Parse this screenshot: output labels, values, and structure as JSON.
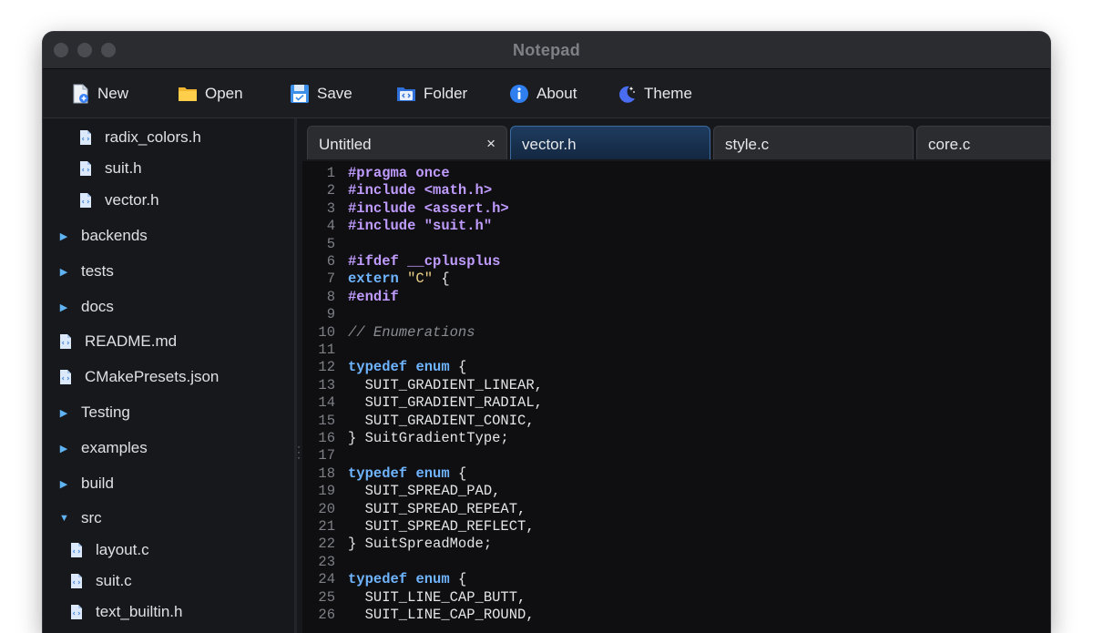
{
  "window": {
    "title": "Notepad"
  },
  "toolbar": {
    "new_label": "New",
    "open_label": "Open",
    "save_label": "Save",
    "folder_label": "Folder",
    "about_label": "About",
    "theme_label": "Theme"
  },
  "sidebar": {
    "items": [
      {
        "label": "radix_colors.h",
        "kind": "file"
      },
      {
        "label": "suit.h",
        "kind": "file"
      },
      {
        "label": "vector.h",
        "kind": "file"
      },
      {
        "label": "backends",
        "kind": "folder-collapsed"
      },
      {
        "label": "tests",
        "kind": "folder-collapsed"
      },
      {
        "label": "docs",
        "kind": "folder-collapsed"
      },
      {
        "label": "README.md",
        "kind": "file"
      },
      {
        "label": "CMakePresets.json",
        "kind": "file"
      },
      {
        "label": "Testing",
        "kind": "folder-collapsed"
      },
      {
        "label": "examples",
        "kind": "folder-collapsed"
      },
      {
        "label": "build",
        "kind": "folder-collapsed"
      },
      {
        "label": "src",
        "kind": "folder-expanded"
      },
      {
        "label": "layout.c",
        "kind": "file"
      },
      {
        "label": "suit.c",
        "kind": "file"
      },
      {
        "label": "text_builtin.h",
        "kind": "file"
      }
    ]
  },
  "tabs": [
    {
      "label": "Untitled",
      "close": "×",
      "active": false
    },
    {
      "label": "vector.h",
      "active": true
    },
    {
      "label": "style.c",
      "active": false
    },
    {
      "label": "core.c",
      "active": false
    }
  ],
  "editor": {
    "lines": [
      {
        "n": "1",
        "t": [
          [
            "kw-purple",
            "#pragma once"
          ]
        ]
      },
      {
        "n": "2",
        "t": [
          [
            "kw-purple",
            "#include <math.h>"
          ]
        ]
      },
      {
        "n": "3",
        "t": [
          [
            "kw-purple",
            "#include <assert.h>"
          ]
        ]
      },
      {
        "n": "4",
        "t": [
          [
            "kw-purple",
            "#include \"suit.h\""
          ]
        ]
      },
      {
        "n": "5",
        "t": []
      },
      {
        "n": "6",
        "t": [
          [
            "kw-purple",
            "#ifdef __cplusplus"
          ]
        ]
      },
      {
        "n": "7",
        "t": [
          [
            "kw-blue",
            "extern"
          ],
          [
            "plain",
            " "
          ],
          [
            "str",
            "\"C\""
          ],
          [
            "plain",
            " {"
          ]
        ]
      },
      {
        "n": "8",
        "t": [
          [
            "kw-purple",
            "#endif"
          ]
        ]
      },
      {
        "n": "9",
        "t": []
      },
      {
        "n": "10",
        "t": [
          [
            "comment",
            "// Enumerations"
          ]
        ]
      },
      {
        "n": "11",
        "t": []
      },
      {
        "n": "12",
        "t": [
          [
            "kw-blue",
            "typedef"
          ],
          [
            "plain",
            " "
          ],
          [
            "kw-blue",
            "enum"
          ],
          [
            "plain",
            " {"
          ]
        ]
      },
      {
        "n": "13",
        "t": [
          [
            "plain",
            "  SUIT_GRADIENT_LINEAR,"
          ]
        ]
      },
      {
        "n": "14",
        "t": [
          [
            "plain",
            "  SUIT_GRADIENT_RADIAL,"
          ]
        ]
      },
      {
        "n": "15",
        "t": [
          [
            "plain",
            "  SUIT_GRADIENT_CONIC,"
          ]
        ]
      },
      {
        "n": "16",
        "t": [
          [
            "plain",
            "} SuitGradientType;"
          ]
        ]
      },
      {
        "n": "17",
        "t": []
      },
      {
        "n": "18",
        "t": [
          [
            "kw-blue",
            "typedef"
          ],
          [
            "plain",
            " "
          ],
          [
            "kw-blue",
            "enum"
          ],
          [
            "plain",
            " {"
          ]
        ]
      },
      {
        "n": "19",
        "t": [
          [
            "plain",
            "  SUIT_SPREAD_PAD,"
          ]
        ]
      },
      {
        "n": "20",
        "t": [
          [
            "plain",
            "  SUIT_SPREAD_REPEAT,"
          ]
        ]
      },
      {
        "n": "21",
        "t": [
          [
            "plain",
            "  SUIT_SPREAD_REFLECT,"
          ]
        ]
      },
      {
        "n": "22",
        "t": [
          [
            "plain",
            "} SuitSpreadMode;"
          ]
        ]
      },
      {
        "n": "23",
        "t": []
      },
      {
        "n": "24",
        "t": [
          [
            "kw-blue",
            "typedef"
          ],
          [
            "plain",
            " "
          ],
          [
            "kw-blue",
            "enum"
          ],
          [
            "plain",
            " {"
          ]
        ]
      },
      {
        "n": "25",
        "t": [
          [
            "plain",
            "  SUIT_LINE_CAP_BUTT,"
          ]
        ]
      },
      {
        "n": "26",
        "t": [
          [
            "plain",
            "  SUIT_LINE_CAP_ROUND,"
          ]
        ]
      }
    ]
  },
  "icons": {
    "file": "code-file-icon",
    "chevron_right": "chevron-right-icon",
    "chevron_down": "chevron-down-icon"
  },
  "colors": {
    "accent": "#6fb4ff",
    "keyword_purple": "#c09cff",
    "string": "#f0d38a",
    "background": "#0f0f12"
  }
}
